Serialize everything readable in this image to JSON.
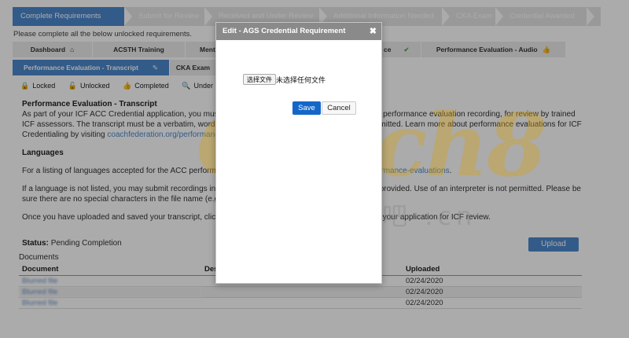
{
  "steps": [
    {
      "label": "Complete Requirements",
      "active": true
    },
    {
      "label": "Submit for Review",
      "active": false
    },
    {
      "label": "Received and Under Review",
      "active": false
    },
    {
      "label": "Additional Information Needed",
      "active": false
    },
    {
      "label": "CKA Exam",
      "active": false
    },
    {
      "label": "Credential Awarded",
      "active": false
    }
  ],
  "note": "Please complete all the below unlocked requirements.",
  "tabs_row1": [
    {
      "label": "Dashboard",
      "icon": "home-icon",
      "icon_glyph": "⌂"
    },
    {
      "label": "ACSTH Training",
      "icon": "",
      "icon_glyph": ""
    },
    {
      "label": "Ment",
      "icon": "",
      "icon_glyph": ""
    },
    {
      "label": "ce",
      "icon": "check-icon",
      "icon_glyph": "✔"
    },
    {
      "label": "Performance Evaluation - Audio",
      "icon": "thumbs-up-icon",
      "icon_glyph": "👍"
    }
  ],
  "tabs_row2": [
    {
      "label": "Performance Evaluation - Transcript",
      "icon": "pencil-icon",
      "icon_glyph": "✎"
    },
    {
      "label": "CKA Exam",
      "icon": "",
      "icon_glyph": ""
    }
  ],
  "legend": [
    {
      "icon": "lock-icon",
      "glyph": "🔒",
      "label": "Locked"
    },
    {
      "icon": "unlock-icon",
      "glyph": "🔓",
      "label": "Unlocked"
    },
    {
      "icon": "thumbs-up-icon",
      "glyph": "👍",
      "label": "Completed"
    },
    {
      "icon": "search-icon",
      "glyph": "🔍",
      "label": "Under Review"
    }
  ],
  "section": {
    "title": "Performance Evaluation - Transcript",
    "para1": "As part of your ICF ACC Credential application, you must submit a written transcript to accompany your performance evaluation recording, for review by trained ICF assessors. The transcript must be a verbatim, word-for-word record of the coaching session(s) submitted. Learn more about performance evaluations for ICF Credentialing by visiting",
    "para1_link": "coachfederation.org/performance-evaluations",
    "para1_end": ".",
    "languages_title": "Languages",
    "para2": "For a listing of languages accepted for the ACC performance evaluation, visit",
    "para2_link": "coachfederation.org/performance-evaluations",
    "para2_end": ".",
    "para3": "If a language is not listed, you may submit recordings in your native language, but a transcript must be provided. Use of an interpreter is not permitted. Please be sure there are no special characters in the file name (e.g. ! @ # = $ % +).",
    "para4": "Once you have uploaded and saved your transcript, click the Submit for Review button above to submit your application for ICF review.",
    "status_label": "Status:",
    "status_value": "Pending Completion",
    "upload_label": "Upload"
  },
  "documents": {
    "title": "Documents",
    "columns": [
      "Document",
      "Des",
      "Uploaded"
    ],
    "rows": [
      {
        "name": "Blurred file",
        "desc": "",
        "uploaded": "02/24/2020"
      },
      {
        "name": "Blurred file",
        "desc": "",
        "uploaded": "02/24/2020"
      },
      {
        "name": "Blurred file",
        "desc": "",
        "uploaded": "02/24/2020"
      }
    ]
  },
  "watermark": {
    "main": "Coach8",
    "sub": "教练吧 .cn"
  },
  "dialog": {
    "title": "Edit - AGS Credential Requirement",
    "close_glyph": "✖",
    "file_button": "选择文件",
    "file_status": "未选择任何文件",
    "save_label": "Save",
    "cancel_label": "Cancel"
  }
}
